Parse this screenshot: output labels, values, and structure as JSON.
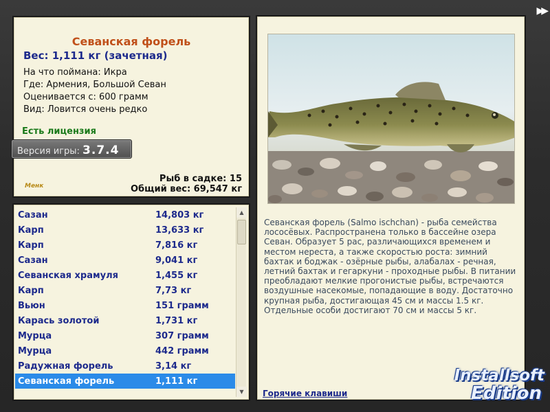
{
  "info": {
    "fish_name": "Севанская форель",
    "weight_line": "Вес: 1,111 кг (зачетная)",
    "caught_on": "На что поймана: Икра",
    "location": "Где: Армения, Большой Севан",
    "rated_from": "Оценивается с: 600 грамм",
    "kind": "Вид: Ловится очень редко",
    "license": "Есть лицензия",
    "version_label": "Версия игры:",
    "version_value": "3.7.4",
    "menu_logo": "Менк",
    "fish_in_keepnet": "Рыб в садке: 15",
    "total_weight": "Общий вес: 69,547 кг"
  },
  "catch_list": [
    {
      "name": "Сазан",
      "weight": "14,803 кг"
    },
    {
      "name": "Карп",
      "weight": "13,633 кг"
    },
    {
      "name": "Карп",
      "weight": "7,816 кг"
    },
    {
      "name": "Сазан",
      "weight": "9,041 кг"
    },
    {
      "name": "Севанская храмуля",
      "weight": "1,455 кг"
    },
    {
      "name": "Карп",
      "weight": "7,73 кг"
    },
    {
      "name": "Вьюн",
      "weight": "151 грамм"
    },
    {
      "name": "Карась золотой",
      "weight": "1,731 кг"
    },
    {
      "name": "Мурца",
      "weight": "307 грамм"
    },
    {
      "name": "Мурца",
      "weight": "442 грамм"
    },
    {
      "name": "Радужная форель",
      "weight": "3,14 кг"
    },
    {
      "name": "Севанская форель",
      "weight": "1,111 кг",
      "selected": true
    }
  ],
  "description": {
    "text": "Севанская форель (Salmo ischchan) - рыба семейства лососёвых. Распространена только в бассейне озера Севан. Образует 5 рас, различающихся временем и местом нереста, а также скоростью роста: зимний бахтак и боджак - озёрные рыбы, алабалах - речная, летний бахтак и гегаркуни - проходные рыбы. В питании преобладают мелкие прогонистые рыбы, встречаются воздушные насекомые, попадающие в воду. Достаточно крупная рыба, достигающая 45 см и массы 1.5 кг. Отдельные особи достигают 70 см и массы 5 кг.",
    "hotkeys_link": "Горячие клавиши"
  },
  "branding": {
    "line1": "Installsoft",
    "line2": "Edition"
  },
  "icons": {
    "next": "double-right-arrow-icon",
    "scroll_up": "arrow-up-icon",
    "scroll_down": "arrow-down-icon"
  },
  "colors": {
    "title": "#c0501a",
    "link": "#1d2a8c",
    "license": "#1a7a1a",
    "selection": "#2b8be8"
  }
}
